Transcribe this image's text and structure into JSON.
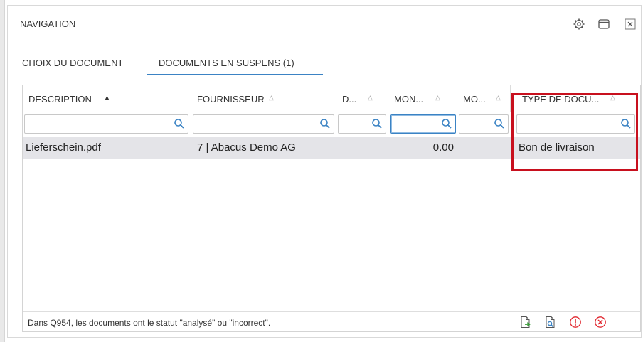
{
  "panel": {
    "title": "NAVIGATION",
    "icons": [
      "gear-icon",
      "window-icon",
      "close-icon"
    ]
  },
  "tabs": [
    {
      "label": "CHOIX DU DOCUMENT",
      "active": false
    },
    {
      "label": "DOCUMENTS EN SUSPENS (1)",
      "active": true
    }
  ],
  "grid": {
    "columns": [
      {
        "label": "DESCRIPTION",
        "sort": "asc"
      },
      {
        "label": "FOURNISSEUR",
        "sort": "none"
      },
      {
        "label": "D...",
        "sort": "none"
      },
      {
        "label": "MON...",
        "sort": "none"
      },
      {
        "label": "MO...",
        "sort": "none"
      },
      {
        "label": "TYPE DE DOCU...",
        "sort": "none"
      }
    ],
    "rows": [
      {
        "description": "Lieferschein.pdf",
        "fournisseur": "7 | Abacus Demo AG",
        "d": "",
        "montant": "0.00",
        "mo": "",
        "type": "Bon de livraison"
      }
    ]
  },
  "footer": {
    "status": "Dans Q954, les documents ont le statut \"analysé\" ou \"incorrect\".",
    "icons": [
      "export-icon",
      "preview-icon",
      "warning-icon",
      "cancel-icon"
    ]
  },
  "colors": {
    "accent": "#3b83c4",
    "highlight": "#c8101e",
    "warning": "#e0262e",
    "export_green": "#3a9d3a"
  }
}
